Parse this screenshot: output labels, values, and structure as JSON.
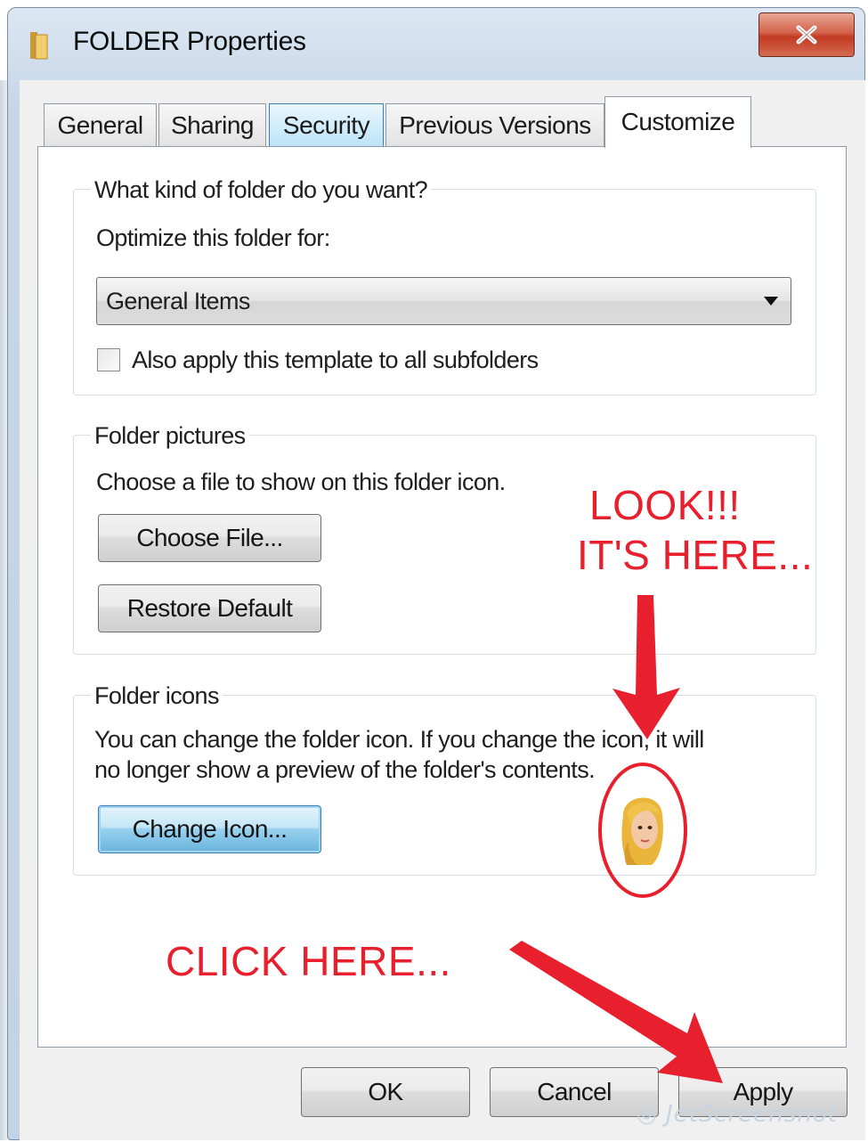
{
  "window": {
    "title": "FOLDER Properties",
    "title_icon": "folder-icon",
    "close_icon": "close-icon",
    "close_button_color": "#c8432b"
  },
  "tabs": [
    {
      "label": "General",
      "state": "normal"
    },
    {
      "label": "Sharing",
      "state": "normal"
    },
    {
      "label": "Security",
      "state": "hover"
    },
    {
      "label": "Previous Versions",
      "state": "normal"
    },
    {
      "label": "Customize",
      "state": "selected"
    }
  ],
  "folder_type_group": {
    "legend": "What kind of folder do you want?",
    "optimize_label": "Optimize this folder for:",
    "selected_type": "General Items",
    "checkbox_label": "Also apply this template to all subfolders",
    "checkbox_checked": false
  },
  "folder_pictures_group": {
    "legend": "Folder pictures",
    "description": "Choose a file to show on this folder icon.",
    "choose_file_label": "Choose File...",
    "restore_default_label": "Restore Default"
  },
  "folder_icons_group": {
    "legend": "Folder icons",
    "description_line1": "You can change the folder icon. If you change the icon, it will",
    "description_line2": "no longer show a preview of the folder's contents.",
    "change_icon_label": "Change Icon...",
    "preview_icon": "avatar-icon"
  },
  "footer": {
    "ok_label": "OK",
    "cancel_label": "Cancel",
    "apply_label": "Apply"
  },
  "annotations": {
    "look_line1": "LOOK!!!",
    "look_line2": "IT'S HERE...",
    "click_here": "CLICK HERE...",
    "color": "#e8202e"
  },
  "watermark": "JetScreenshot"
}
